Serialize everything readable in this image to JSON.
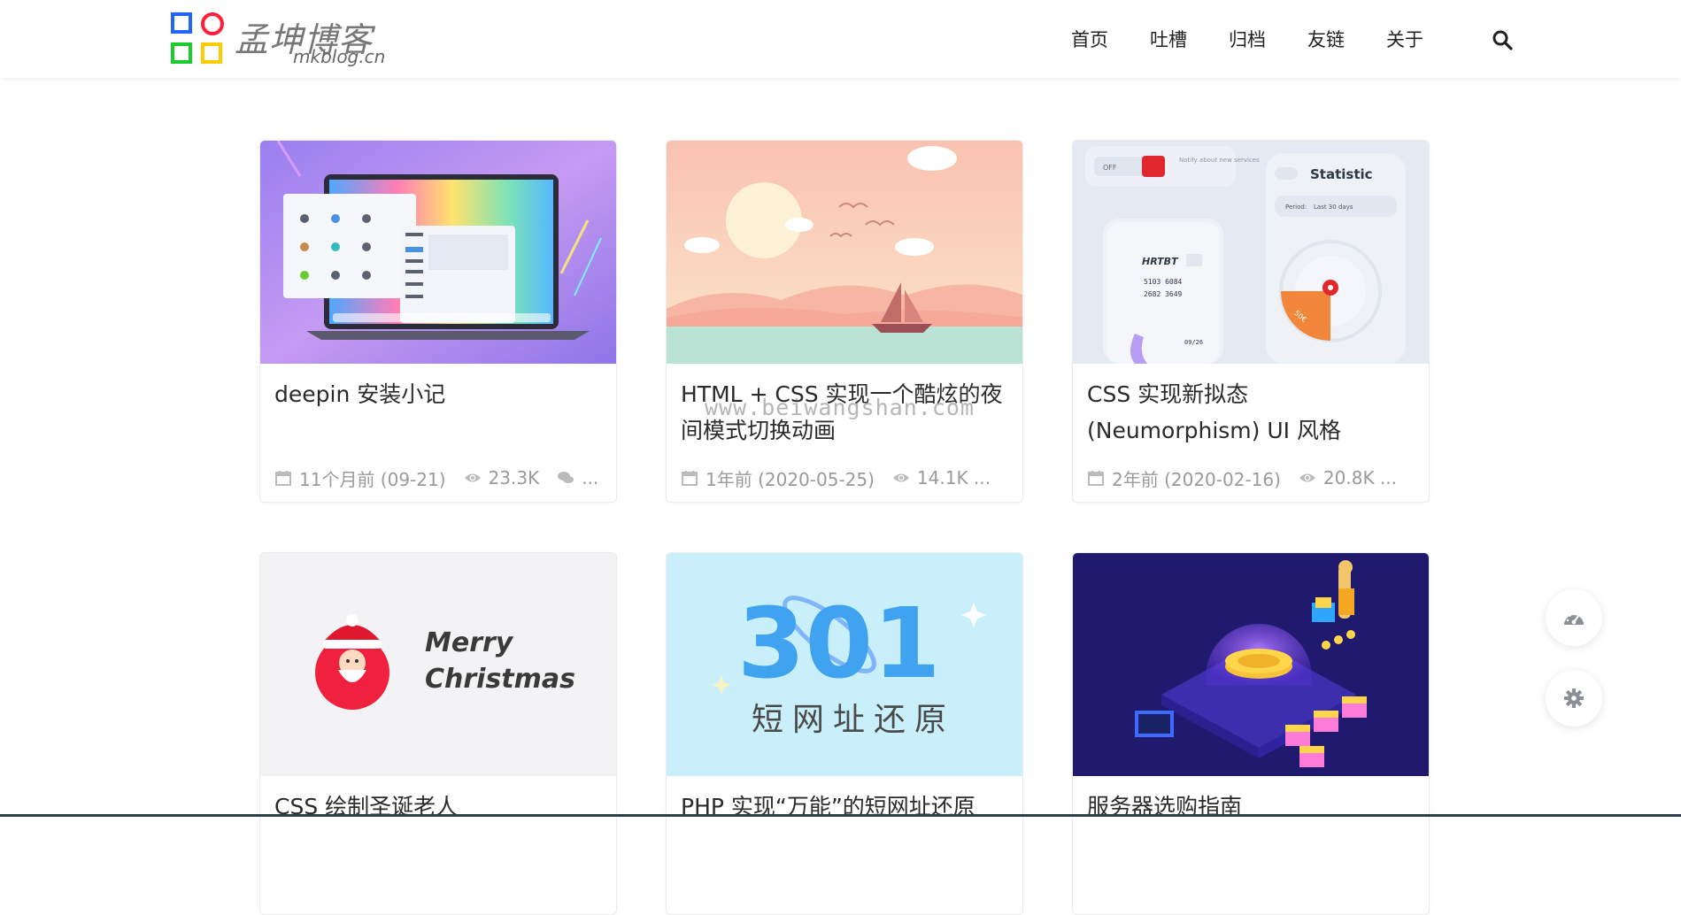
{
  "header": {
    "logo_title": "孟坤博客",
    "logo_sub": "mkblog.cn",
    "nav": [
      "首页",
      "吐槽",
      "归档",
      "友链",
      "关于"
    ]
  },
  "watermark": "www.beiwangshan.com",
  "cards": [
    {
      "title": "deepin 安装小记",
      "date": "11个月前 (09-21)",
      "views": "23.3K",
      "comments": "..."
    },
    {
      "title": "HTML + CSS 实现一个酷炫的夜间模式切换动画",
      "date": "1年前 (2020-05-25)",
      "views": "14.1K ..."
    },
    {
      "title": "CSS 实现新拟态(Neumorphism) UI 风格",
      "date": "2年前 (2020-02-16)",
      "views": "20.8K ...",
      "thumb": {
        "statistic": "Statistic",
        "period": "Period:",
        "period_value": "Last 30 days",
        "off": "OFF",
        "notify": "Notify about new services",
        "card_brand": "HRTBT",
        "card_number_1": "5103 6084",
        "card_number_2": "2682 3649",
        "card_exp": "09/26",
        "gauge_label": "50€"
      }
    },
    {
      "title": "CSS 绘制圣诞老人",
      "thumb": {
        "line1": "Merry",
        "line2": "Christmas"
      }
    },
    {
      "title": "PHP 实现“万能”的短网址还原",
      "thumb": {
        "big": "301",
        "sub": "短网址还原"
      }
    },
    {
      "title": "服务器选购指南"
    }
  ],
  "colors": {
    "accent_blue": "#1e64ff",
    "accent_red": "#ff1f3b",
    "accent_green": "#19cc2c",
    "accent_yellow": "#ffcc00"
  }
}
